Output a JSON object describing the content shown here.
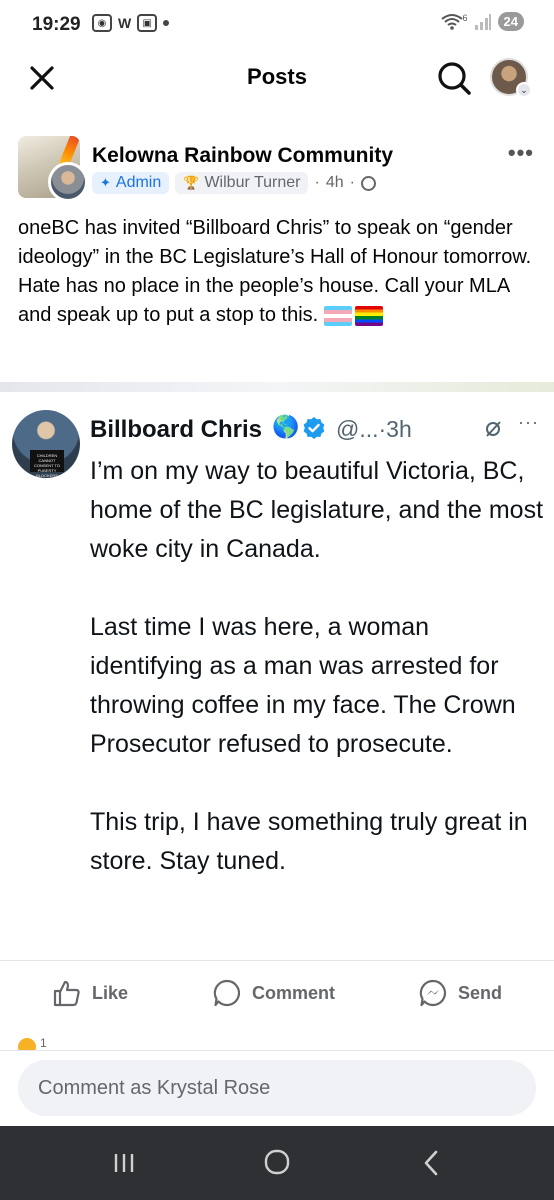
{
  "status_bar": {
    "time": "19:29",
    "battery": "24",
    "left_w_label": "W",
    "signal_label": "6"
  },
  "header": {
    "title": "Posts"
  },
  "post": {
    "group_name": "Kelowna Rainbow Community",
    "admin_label": "Admin",
    "author": "Wilbur Turner",
    "time": "4h",
    "text": "oneBC has invited “Billboard Chris” to speak on “gender ideology” in the BC Legislature’s Hall of Honour tomorrow. Hate has no place in the people’s house. Call your MLA and speak up to put a stop to this."
  },
  "tweet": {
    "name": "Billboard Chris",
    "globe_emoji": "🌎",
    "handle_time": "@...·3h",
    "body": "I’m on my way to beautiful Victoria, BC, home of the BC legislature, and the most woke city in Canada.\n\nLast time I was here, a woman identifying as a man was arrested for throwing coffee in my face. The Crown Prosecutor refused to prosecute.\n\nThis trip, I have something truly great in store. Stay tuned.",
    "sign_text": "CHILDREN CANNOT CONSENT TO PUBERTY BLOCKERS"
  },
  "actions": {
    "like": "Like",
    "comment": "Comment",
    "send": "Send"
  },
  "reactions": {
    "count": "1"
  },
  "comment_box": {
    "placeholder": "Comment as Krystal Rose"
  },
  "colors": {
    "facebook_blue": "#1b74e4",
    "twitter_verified": "#1d9bf0",
    "secondary_text": "#65676b",
    "nav_bar": "#2f3033"
  },
  "icons": [
    "close-icon",
    "search-icon",
    "more-icon",
    "admin-badge-icon",
    "trophy-icon",
    "globe-icon",
    "verified-icon",
    "like-icon",
    "comment-icon",
    "send-icon",
    "nav-recents-icon",
    "nav-home-icon",
    "nav-back-icon"
  ]
}
